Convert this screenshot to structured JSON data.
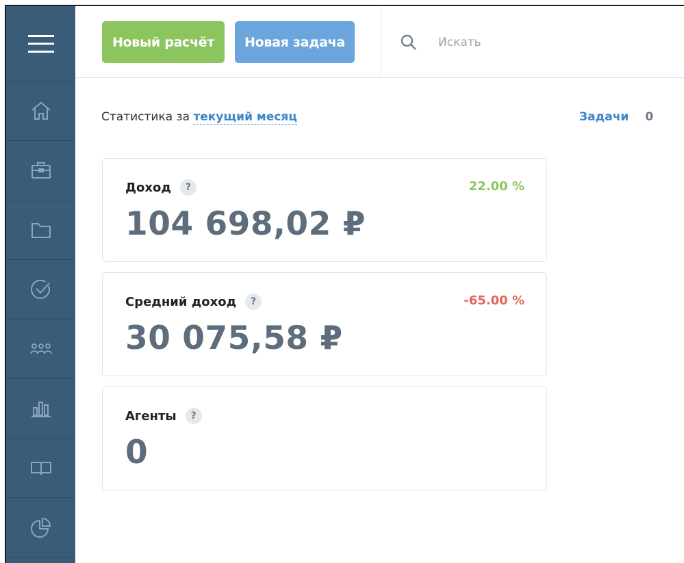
{
  "sidebar": {
    "items": [
      {
        "name": "menu",
        "icon": "hamburger-icon"
      },
      {
        "name": "home",
        "icon": "home-icon"
      },
      {
        "name": "briefcase",
        "icon": "briefcase-icon"
      },
      {
        "name": "folder",
        "icon": "folder-icon"
      },
      {
        "name": "tasks",
        "icon": "check-circle-icon"
      },
      {
        "name": "agents",
        "icon": "people-icon"
      },
      {
        "name": "reports",
        "icon": "bar-chart-icon"
      },
      {
        "name": "library",
        "icon": "book-icon"
      },
      {
        "name": "analytics",
        "icon": "pie-chart-icon"
      }
    ]
  },
  "toolbar": {
    "new_calc_label": "Новый расчёт",
    "new_task_label": "Новая задача",
    "search_placeholder": "Искать"
  },
  "stats": {
    "prefix": "Статистика за ",
    "period_link": "текущий месяц"
  },
  "tasks": {
    "label": "Задачи",
    "count": "0"
  },
  "cards": [
    {
      "title": "Доход",
      "value": "104 698,02 ₽",
      "change": "22.00 %",
      "trend": "positive"
    },
    {
      "title": "Средний доход",
      "value": "30 075,58 ₽",
      "change": "-65.00 %",
      "trend": "negative"
    },
    {
      "title": "Агенты",
      "value": "0"
    }
  ],
  "help_glyph": "?",
  "colors": {
    "sidebar_bg": "#3b5c78",
    "green_button": "#8cc45e",
    "blue_button": "#6aa6dc",
    "link": "#3e86c8",
    "positive": "#8cc45e",
    "negative": "#e0685a"
  }
}
